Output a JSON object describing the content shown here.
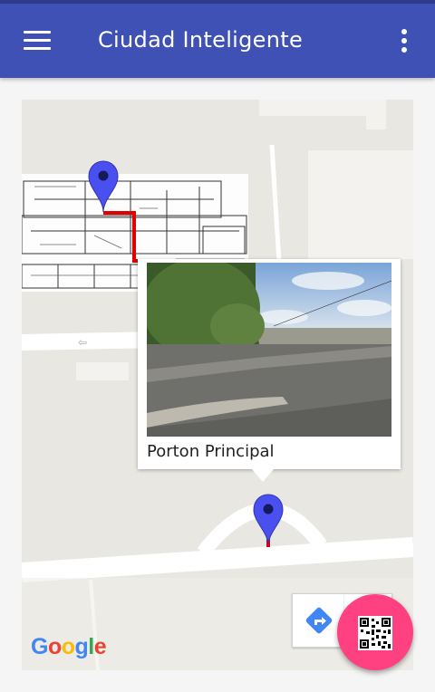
{
  "app_bar": {
    "title": "Ciudad Inteligente",
    "menu_icon": "hamburger-menu-icon",
    "overflow_icon": "more-vert-icon"
  },
  "map": {
    "attribution": "Google",
    "markers": [
      "destination-marker",
      "origin-marker"
    ],
    "route_color": "#e00000",
    "marker_color": "#4a4ff0"
  },
  "info_window": {
    "title": "Porton Principal"
  },
  "controls": {
    "directions_icon": "directions-icon",
    "fab_icon": "qr-code-icon",
    "fab_color": "#ff4081"
  },
  "colors": {
    "primary": "#3f51b5",
    "primary_dark": "#2e3a8c"
  }
}
